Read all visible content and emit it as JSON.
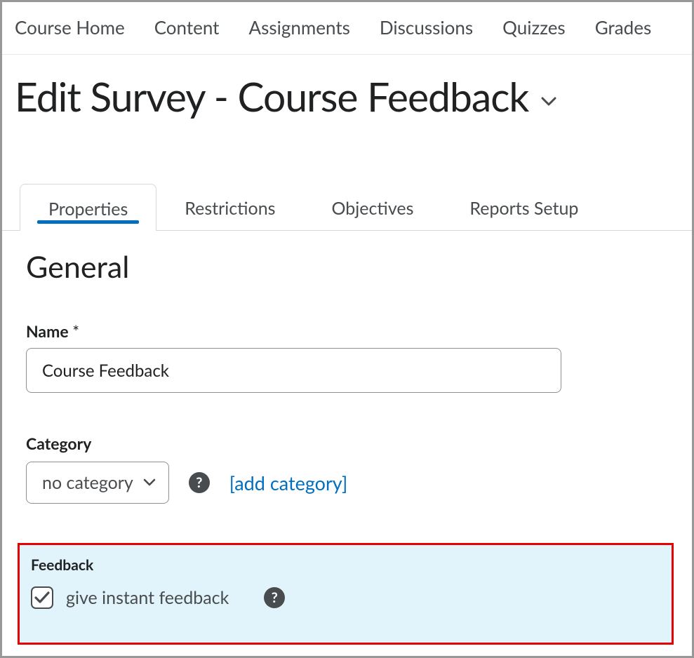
{
  "nav": {
    "items": [
      "Course Home",
      "Content",
      "Assignments",
      "Discussions",
      "Quizzes",
      "Grades"
    ]
  },
  "page": {
    "title": "Edit Survey - Course Feedback"
  },
  "tabs": [
    {
      "label": "Properties",
      "active": true
    },
    {
      "label": "Restrictions",
      "active": false
    },
    {
      "label": "Objectives",
      "active": false
    },
    {
      "label": "Reports Setup",
      "active": false
    }
  ],
  "section": {
    "heading": "General",
    "name_label": "Name",
    "name_required_mark": "*",
    "name_value": "Course Feedback",
    "category_label": "Category",
    "category_selected": "no category",
    "add_category_text": "[add category]"
  },
  "feedback": {
    "label": "Feedback",
    "checkbox_checked": true,
    "checkbox_label": "give instant feedback"
  },
  "icons": {
    "help_char": "?"
  }
}
